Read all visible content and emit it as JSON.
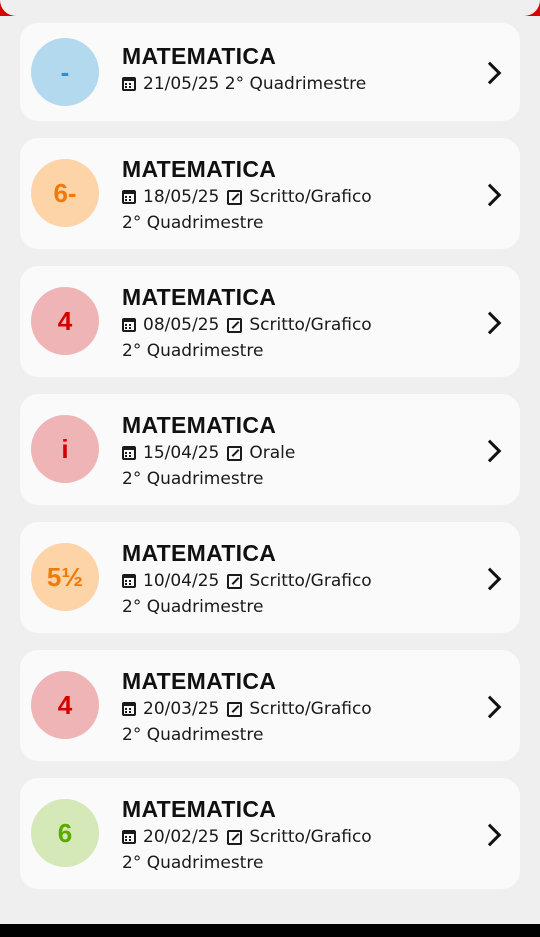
{
  "colors": {
    "blue_bg": "#b3d9ef",
    "blue_fg": "#2b8fd0",
    "orange_bg": "#fdd3a8",
    "orange_fg": "#f07a06",
    "red_bg": "#efb4b6",
    "red_fg": "#d40000",
    "green_bg": "#d5e8b8",
    "green_fg": "#5aaa00"
  },
  "grades": [
    {
      "grade": "-",
      "subject": "MATEMATICA",
      "date": "21/05/25",
      "type": "",
      "period": "2° Quadrimestre",
      "color": "blue"
    },
    {
      "grade": "6-",
      "subject": "MATEMATICA",
      "date": "18/05/25",
      "type": "Scritto/Grafico",
      "period": "2° Quadrimestre",
      "color": "orange"
    },
    {
      "grade": "4",
      "subject": "MATEMATICA",
      "date": "08/05/25",
      "type": "Scritto/Grafico",
      "period": "2° Quadrimestre",
      "color": "red"
    },
    {
      "grade": "i",
      "subject": "MATEMATICA",
      "date": "15/04/25",
      "type": "Orale",
      "period": "2° Quadrimestre",
      "color": "red"
    },
    {
      "grade": "5½",
      "subject": "MATEMATICA",
      "date": "10/04/25",
      "type": "Scritto/Grafico",
      "period": "2° Quadrimestre",
      "color": "orange"
    },
    {
      "grade": "4",
      "subject": "MATEMATICA",
      "date": "20/03/25",
      "type": "Scritto/Grafico",
      "period": "2° Quadrimestre",
      "color": "red"
    },
    {
      "grade": "6",
      "subject": "MATEMATICA",
      "date": "20/02/25",
      "type": "Scritto/Grafico",
      "period": "2° Quadrimestre",
      "color": "green"
    }
  ]
}
